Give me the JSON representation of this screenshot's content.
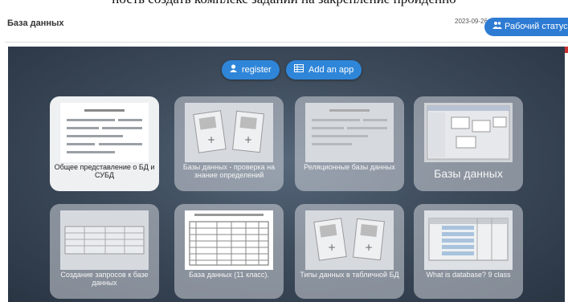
{
  "top_caption": "ность создать комплекс заданий на закрепление пройденно",
  "header": {
    "title": "База данных",
    "date": "2023-09-26",
    "status_button": "Рабочий статус"
  },
  "toolbar": {
    "register_label": "register",
    "add_app_label": "Add an app"
  },
  "tiles": [
    {
      "label": "Общее представление о БД и СУБД"
    },
    {
      "label": "Базы данных - проверка на знание определений"
    },
    {
      "label": "Реляционные базы данных"
    },
    {
      "label": "Базы данных"
    },
    {
      "label": "Создание запросов к базе данных"
    },
    {
      "label": "База данных (11 класс)."
    },
    {
      "label": "Типы данных в табличной БД"
    },
    {
      "label": "What is database? 9 class"
    }
  ]
}
